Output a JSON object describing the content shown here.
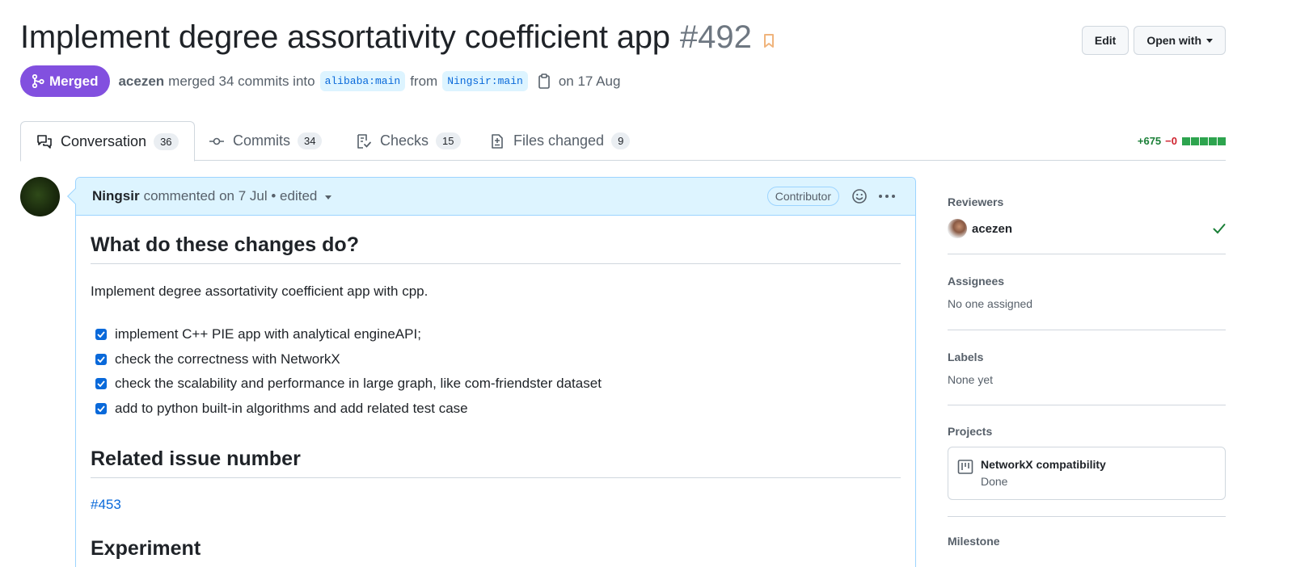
{
  "header": {
    "title": "Implement degree assortativity coefficient app",
    "number": "#492",
    "edit_label": "Edit",
    "open_with_label": "Open with"
  },
  "meta": {
    "state": "Merged",
    "author": "acezen",
    "merged_text": "merged 34 commits into",
    "base_branch": "alibaba:main",
    "from_text": "from",
    "head_branch": "Ningsir:main",
    "date_text": "on 17 Aug"
  },
  "tabs": [
    {
      "label": "Conversation",
      "count": "36",
      "icon": "comment-discussion-icon"
    },
    {
      "label": "Commits",
      "count": "34",
      "icon": "git-commit-icon"
    },
    {
      "label": "Checks",
      "count": "15",
      "icon": "checklist-icon"
    },
    {
      "label": "Files changed",
      "count": "9",
      "icon": "file-diff-icon"
    }
  ],
  "diffstat": {
    "additions": "+675",
    "deletions": "−0",
    "blocks": 5
  },
  "comment": {
    "author": "Ningsir",
    "meta_text": "commented on 7 Jul • edited",
    "role": "Contributor",
    "h1": "What do these changes do?",
    "summary": "Implement degree assortativity coefficient app with cpp.",
    "tasks": [
      {
        "text": "implement C++ PIE app with analytical engineAPI;",
        "checked": true
      },
      {
        "text": "check the correctness with NetworkX",
        "checked": true
      },
      {
        "text": "check the scalability and performance in large graph, like com-friendster dataset",
        "checked": true
      },
      {
        "text": "add to python built-in algorithms and add related test case",
        "checked": true
      }
    ],
    "h2": "Related issue number",
    "issue": "#453",
    "h3": "Experiment"
  },
  "sidebar": {
    "reviewers_title": "Reviewers",
    "reviewer": "acezen",
    "assignees_title": "Assignees",
    "assignees_value": "No one assigned",
    "labels_title": "Labels",
    "labels_value": "None yet",
    "projects_title": "Projects",
    "project_name": "NetworkX compatibility",
    "project_status": "Done",
    "milestone_title": "Milestone"
  },
  "colors": {
    "merged": "#8250df",
    "link": "#0969da",
    "add": "#1a7f37",
    "del": "#cf222e",
    "comment_header": "#ddf4ff"
  }
}
